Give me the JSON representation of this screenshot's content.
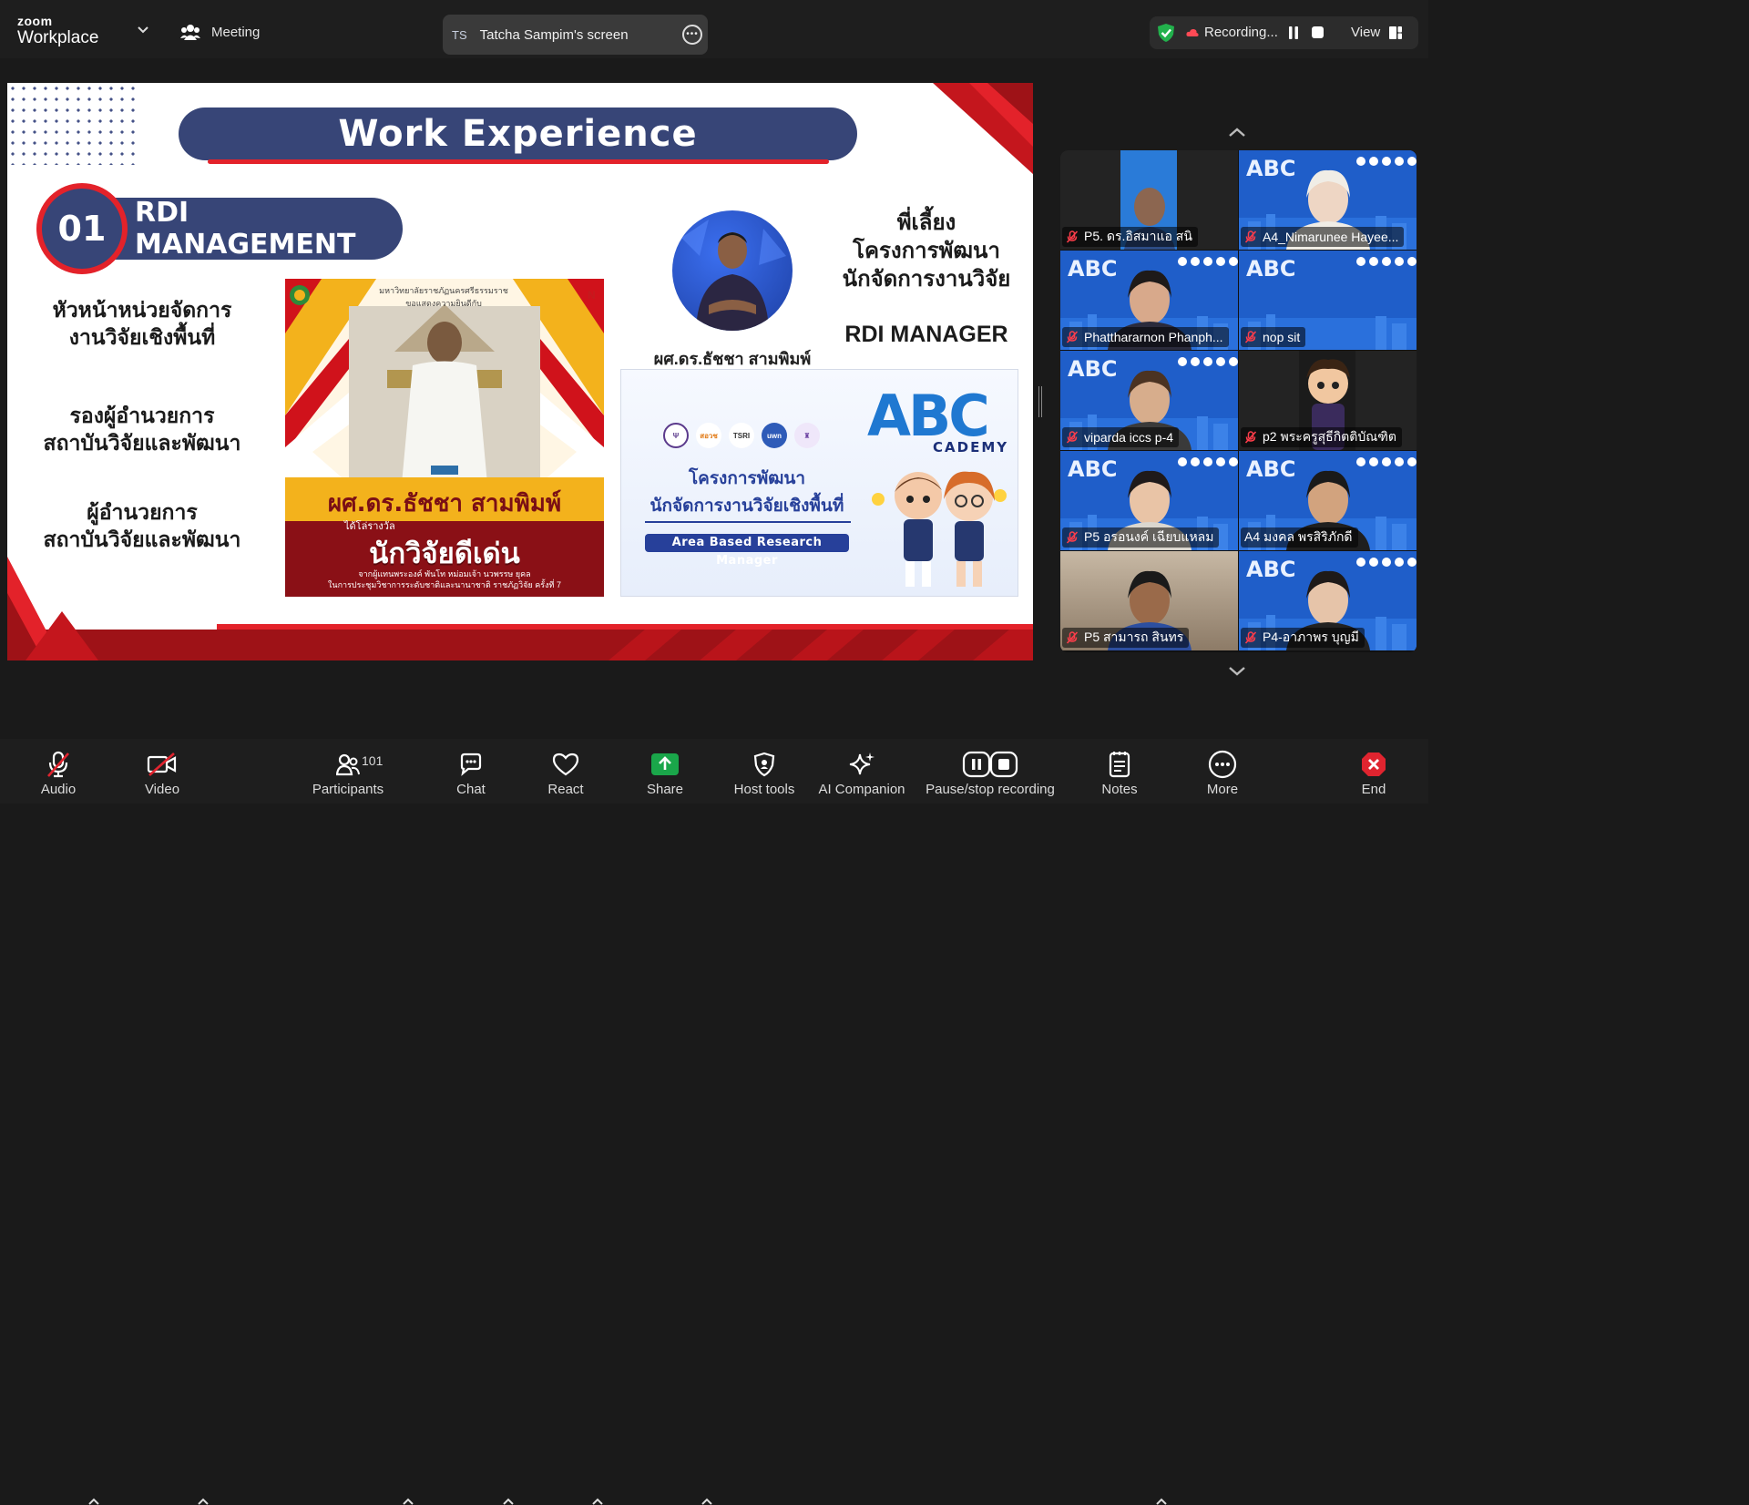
{
  "app": {
    "brand_top": "zoom",
    "brand_bottom": "Workplace",
    "meeting_label": "Meeting"
  },
  "share": {
    "initials": "TS",
    "title": "Tatcha Sampim's screen"
  },
  "recording": {
    "status": "Recording...",
    "view_label": "View"
  },
  "slide": {
    "title": "Work  Experience",
    "section_number": "01",
    "section_title": "RDI MANAGEMENT",
    "roles": [
      {
        "line1": "หัวหน้าหน่วยจัดการ",
        "line2": "งานวิจัยเชิงพื้นที่"
      },
      {
        "line1": "รองผู้อำนวยการ",
        "line2": "สถาบันวิจัยและพัฒนา"
      },
      {
        "line1": "ผู้อำนวยการ",
        "line2": "สถาบันวิจัยและพัฒนา"
      }
    ],
    "award_card": {
      "header_line1": "มหาวิทยาลัยราชภัฏนครศรีธรรมราช",
      "header_line2": "ขอแสดงความยินดีกับ",
      "name": "ผศ.ดร.ธัชชา สามพิมพ์",
      "sub": "ได้โล่รางวัล",
      "award": "นักวิจัยดีเด่น",
      "footer_line1": "จากผู้แทนพระองค์ พันโท หม่อมเจ้า นวพรรษ ยุคล",
      "footer_line2": "ในการประชุมวิชาการระดับชาติและนานาชาติ ราชภัฏวิจัย ครั้งที่ 7"
    },
    "person_name": "ผศ.ดร.ธัชชา สามพิมพ์",
    "mentor": {
      "line1": "พี่เลี้ยง",
      "line2": "โครงการพัฒนา",
      "line3": "นักจัดการงานวิจัย"
    },
    "rdi_manager": "RDI MANAGER",
    "abc_card": {
      "line1": "โครงการพัฒนา",
      "line2": "นักจัดการงานวิจัยเชิงพื้นที่",
      "tag": "Area Based Research Manager",
      "logo_main": "ABC",
      "logo_sub": "CADEMY",
      "partner_logos": [
        "สอวช",
        "TSRI",
        "uwn"
      ]
    }
  },
  "gallery": {
    "participants": [
      {
        "name": "P5. ดร.อิสมาแอ สนิ",
        "muted": true,
        "bg": "dark"
      },
      {
        "name": "A4_Nimarunee Hayee...",
        "muted": true,
        "bg": "abc"
      },
      {
        "name": "Phatthararnon Phanph...",
        "muted": true,
        "bg": "abc"
      },
      {
        "name": "nop sit",
        "muted": true,
        "bg": "abc"
      },
      {
        "name": "viparda iccs p-4",
        "muted": true,
        "bg": "abc"
      },
      {
        "name": "p2 พระครูสุธีกิตติบัณฑิต",
        "muted": true,
        "bg": "dark"
      },
      {
        "name": "P5 อรอนงค์ เฉียบแหลม",
        "muted": true,
        "bg": "abc"
      },
      {
        "name": "A4 มงคล พรสิริภักดี",
        "muted": false,
        "bg": "abc"
      },
      {
        "name": "P5 สามารถ สินทร",
        "muted": true,
        "bg": "room"
      },
      {
        "name": "P4-อาภาพร บุญมี",
        "muted": true,
        "bg": "abc"
      }
    ]
  },
  "toolbar": {
    "audio": "Audio",
    "video": "Video",
    "participants": "Participants",
    "participant_count": "101",
    "chat": "Chat",
    "react": "React",
    "share": "Share",
    "host_tools": "Host tools",
    "ai_companion": "AI Companion",
    "pause_stop": "Pause/stop recording",
    "notes": "Notes",
    "more": "More",
    "end": "End"
  },
  "colors": {
    "brand_navy": "#374577",
    "accent_red": "#e3222a",
    "share_green": "#1aa64a",
    "end_red": "#e0242f"
  }
}
